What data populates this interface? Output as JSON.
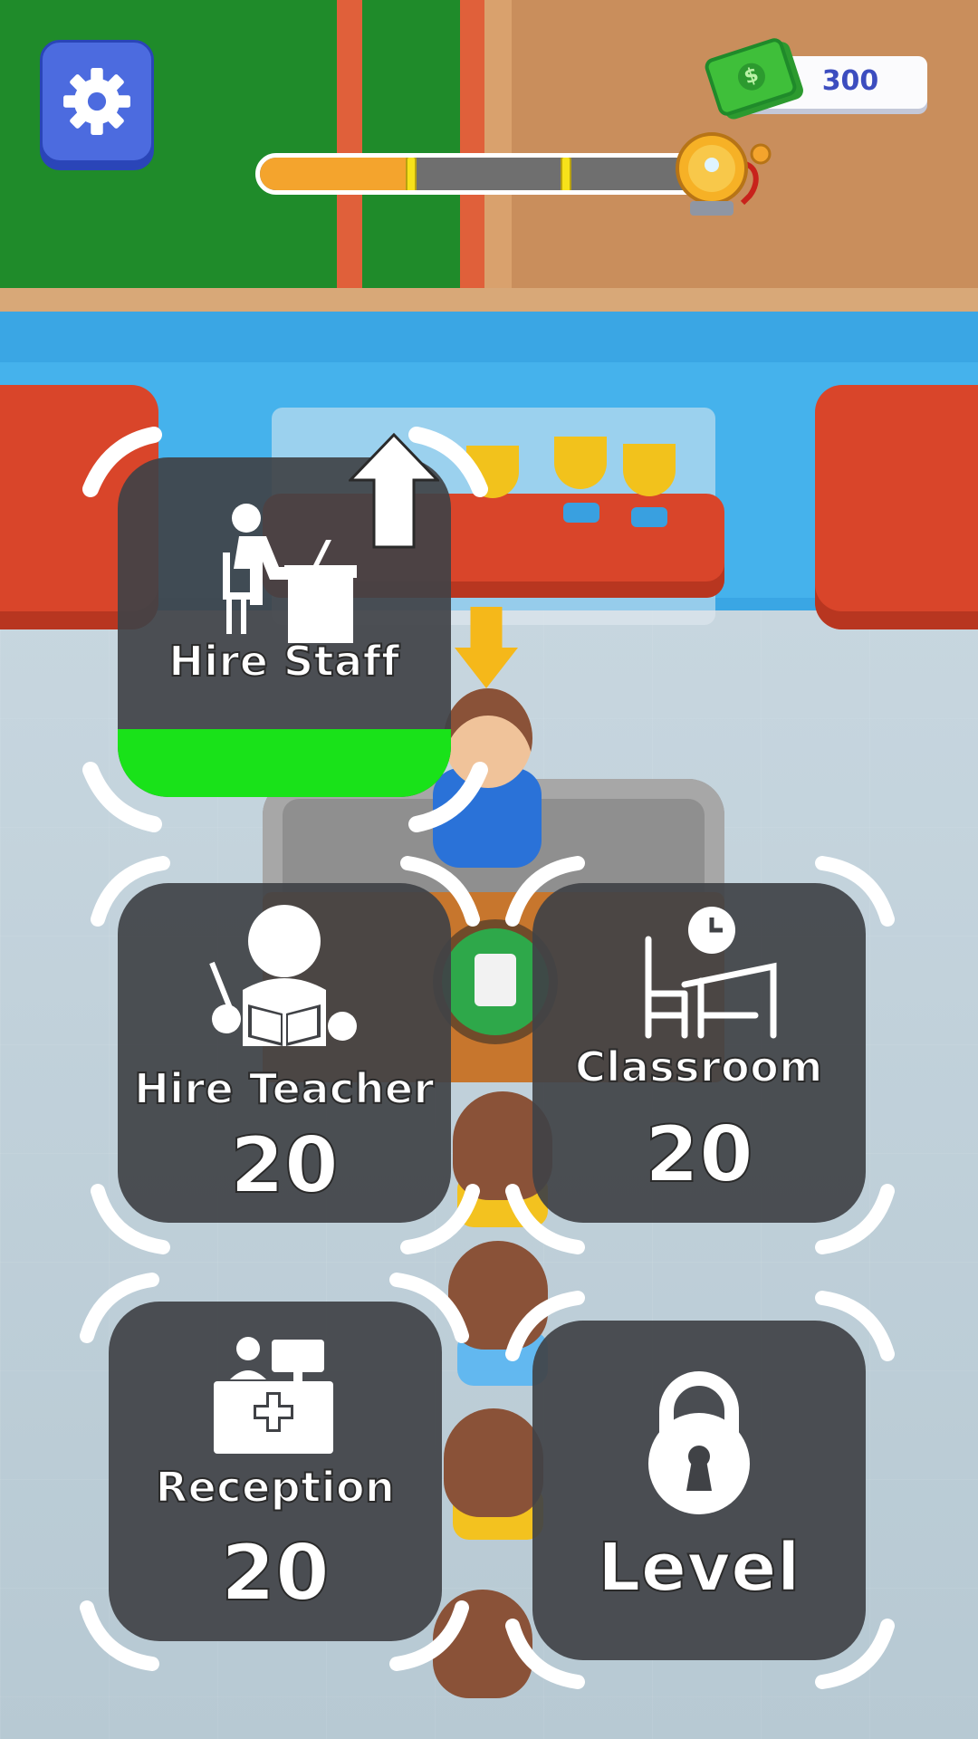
{
  "hud": {
    "settings_icon": "gear-icon",
    "cash_icon": "dollar-bill-icon",
    "cash_symbol": "$",
    "cash": "300",
    "level_progress": 0.34,
    "progress_markers": [
      0.34,
      0.69
    ],
    "bell_icon": "school-bell-icon",
    "colors": {
      "progress_fill": "#f4a42d",
      "progress_track": "#6f6f6f",
      "marker": "#f7e21a",
      "settings": "#4c6bdf"
    }
  },
  "upgrades": {
    "hire_staff": {
      "label": "Hire Staff",
      "icon": "staff-at-desk-icon",
      "progress": 0.2,
      "upgrade_arrow_icon": "up-arrow-icon",
      "fill_color": "#19e219"
    },
    "hire_teacher": {
      "label": "Hire Teacher",
      "icon": "teacher-reading-icon",
      "cost": "20"
    },
    "classroom": {
      "label": "Classroom",
      "icon": "desk-and-clock-icon",
      "cost": "20"
    },
    "reception": {
      "label": "Reception",
      "icon": "reception-desk-icon",
      "cost": "20"
    },
    "level": {
      "label": "Level",
      "icon": "lock-icon"
    }
  },
  "scene": {
    "desk_icon": "admission-clipboard-icon",
    "pointer_icon": "down-arrow-icon"
  }
}
